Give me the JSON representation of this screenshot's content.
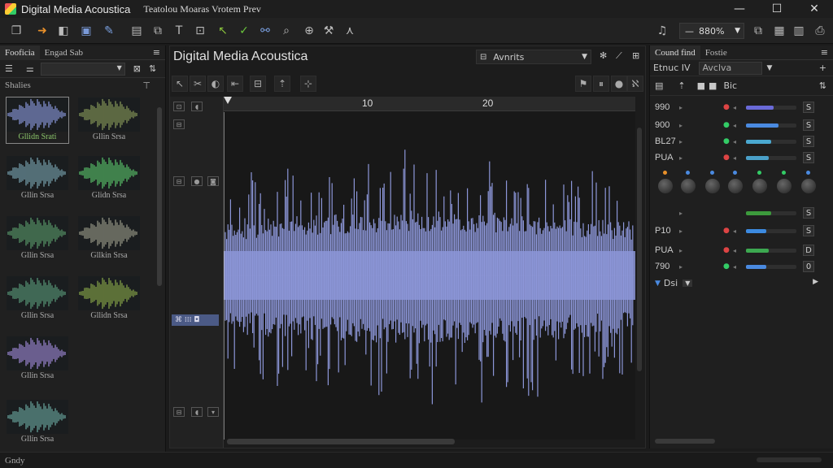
{
  "window": {
    "app_title": "Digital Media Acoustica",
    "menu_text": "Teatolou   Moaras Vrotem Prev",
    "minimize": "—",
    "maximize": "☐",
    "close": "✕"
  },
  "toolbar": {
    "icons": [
      "copy-icon",
      "arrow-right-icon",
      "layers-icon",
      "save-icon",
      "pen-icon",
      "clipboard-icon",
      "cut-icon",
      "text-icon",
      "pointer-icon",
      "check-icon",
      "link-icon",
      "search-icon",
      "globe-icon",
      "tool-icon",
      "node-icon"
    ],
    "bell": "🔔",
    "zoom_value": "880%",
    "zoom_prefix": "—"
  },
  "left_panel": {
    "tabs": [
      "Fooficia",
      "Engad Sab"
    ],
    "section_label": "Shalies",
    "thumbnails": [
      {
        "label": "Gllidn Srati",
        "color": "#8c9ae0",
        "selected": true
      },
      {
        "label": "Gllin Srsa",
        "color": "#8a9a5a",
        "selected": false
      },
      {
        "label": "Gllin Srsa",
        "color": "#7aa4b2",
        "selected": false
      },
      {
        "label": "Glidn Srsa",
        "color": "#5ac46a",
        "selected": false
      },
      {
        "label": "Gllin Srsa",
        "color": "#5a9a6a",
        "selected": false
      },
      {
        "label": "Gllkin Srsa",
        "color": "#9a9a8a",
        "selected": false
      },
      {
        "label": "Gllin Srsa",
        "color": "#5a9a7a",
        "selected": false
      },
      {
        "label": "Gllidn Srsa",
        "color": "#8aa84a",
        "selected": false
      },
      {
        "label": "Gllin Srsa",
        "color": "#a08ad8",
        "selected": false
      },
      {
        "label": "Gllin Srsa",
        "color": "#6aa8a0",
        "selected": false
      }
    ]
  },
  "center": {
    "title": "Digital Media Acoustica",
    "view_label": "Avnrits",
    "ruler_labels": [
      "10",
      "20"
    ],
    "waveform_color": "#8c96d8"
  },
  "right_panel": {
    "tabs": [
      "Cound find",
      "Fostie"
    ],
    "row2_label": "Etnuc IV",
    "row2_select": "Avclva",
    "row3_label": "Bic",
    "channels": [
      {
        "name": "990",
        "level": 0.55,
        "color": "#6a6ad8",
        "s": "S",
        "dot": "#d44"
      },
      {
        "name": "900",
        "level": 0.65,
        "color": "#4a8ae0",
        "s": "S",
        "dot": "#3c6"
      },
      {
        "name": "BL27",
        "level": 0.5,
        "color": "#4aa8d0",
        "s": "S",
        "dot": "#3c6"
      },
      {
        "name": "PUA",
        "level": 0.45,
        "color": "#4aa0c8",
        "s": "S",
        "dot": "#d44"
      },
      {
        "name": "",
        "level": 0.5,
        "color": "#3c9a3c",
        "s": "S",
        "dot": ""
      },
      {
        "name": "P10",
        "level": 0.4,
        "color": "#3c8ae0",
        "s": "S",
        "dot": "#d44"
      },
      {
        "name": "PUA",
        "level": 0.45,
        "color": "#3ca850",
        "s": "D",
        "dot": "#d44"
      },
      {
        "name": "790",
        "level": 0.4,
        "color": "#4a8ae0",
        "s": "0",
        "dot": "#3c6"
      }
    ],
    "bottom_label": "Dsi"
  },
  "status": {
    "text": "Gndy"
  }
}
